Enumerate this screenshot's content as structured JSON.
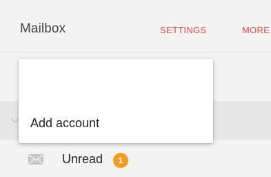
{
  "header": {
    "title": "Mailbox",
    "settings_label": "SETTINGS",
    "more_label": "MORE"
  },
  "dropdown": {
    "items": [
      {
        "label": ""
      },
      {
        "label": "Add account"
      }
    ]
  },
  "folders": [
    {
      "label": "Unread",
      "icon": "envelope-icon",
      "badge": "1"
    }
  ],
  "colors": {
    "accent": "#e0473d",
    "badge": "#f19a24",
    "background": "#f4f4f4",
    "section_band": "#e6e6e6"
  }
}
